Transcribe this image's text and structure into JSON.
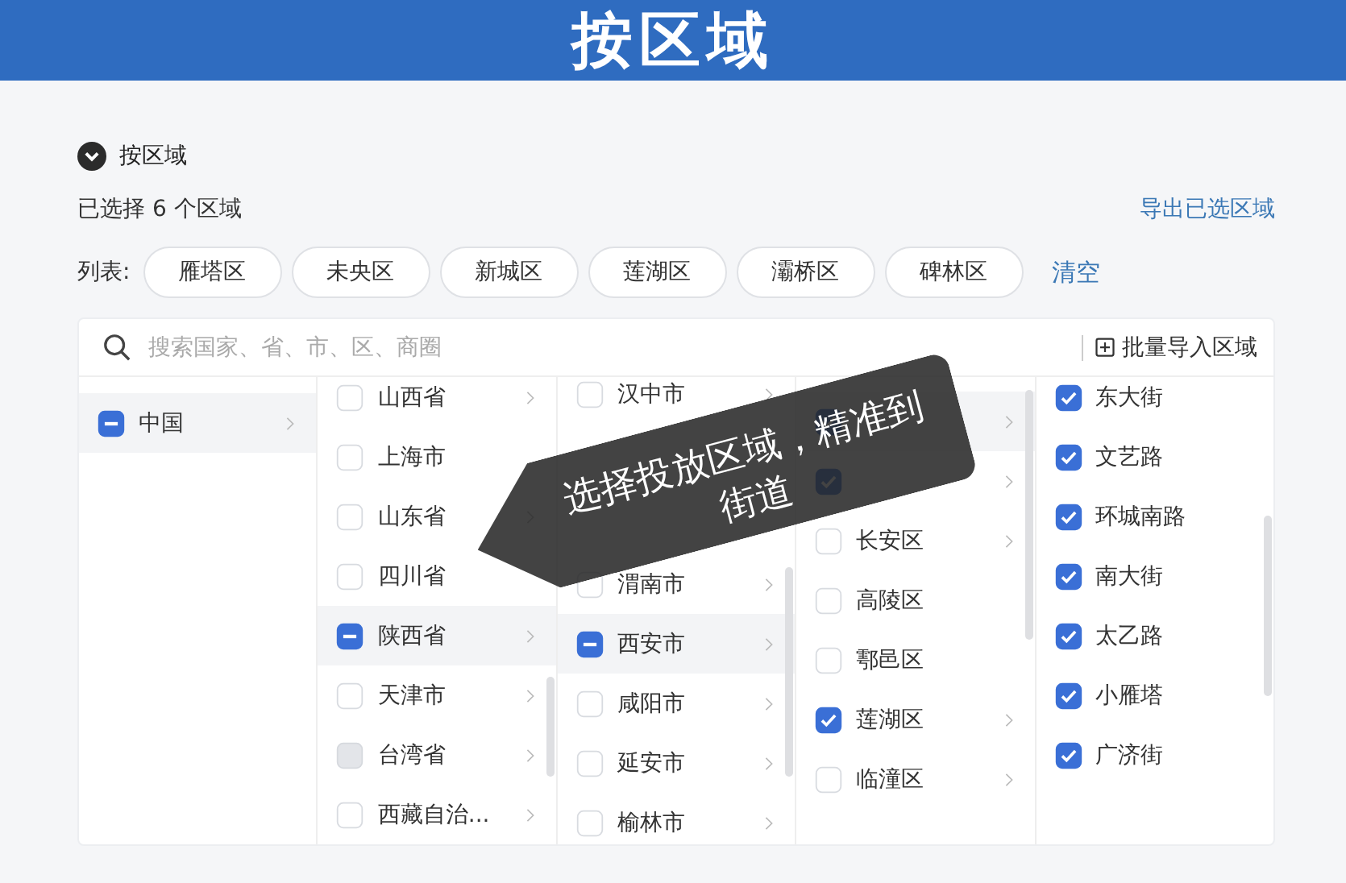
{
  "header": {
    "title": "按区域"
  },
  "section": {
    "title": "按区域",
    "expanded": true
  },
  "summary": {
    "text": "已选择 6 个区域",
    "export_link": "导出已选区域"
  },
  "chips": {
    "label": "列表:",
    "items": [
      "雁塔区",
      "未央区",
      "新城区",
      "莲湖区",
      "灞桥区",
      "碑林区"
    ],
    "clear_link": "清空"
  },
  "search": {
    "placeholder": "搜索国家、省、市、区、商圈",
    "import_button": "批量导入区域"
  },
  "columns": [
    {
      "rows": [
        {
          "kind": "option",
          "label": "中国",
          "checked": false,
          "indeterminate": true,
          "disabled": false,
          "selected": true,
          "expandable": true
        }
      ]
    },
    {
      "rows": [
        {
          "kind": "option",
          "label": "山西省",
          "checked": false,
          "indeterminate": false,
          "disabled": false,
          "selected": false,
          "expandable": true
        },
        {
          "kind": "option",
          "label": "上海市",
          "checked": false,
          "indeterminate": false,
          "disabled": false,
          "selected": false,
          "expandable": false
        },
        {
          "kind": "option",
          "label": "山东省",
          "checked": false,
          "indeterminate": false,
          "disabled": false,
          "selected": false,
          "expandable": true
        },
        {
          "kind": "option",
          "label": "四川省",
          "checked": false,
          "indeterminate": false,
          "disabled": false,
          "selected": false,
          "expandable": false
        },
        {
          "kind": "option",
          "label": "陕西省",
          "checked": false,
          "indeterminate": true,
          "disabled": false,
          "selected": true,
          "expandable": true
        },
        {
          "kind": "option",
          "label": "天津市",
          "checked": false,
          "indeterminate": false,
          "disabled": false,
          "selected": false,
          "expandable": true
        },
        {
          "kind": "option",
          "label": "台湾省",
          "checked": false,
          "indeterminate": false,
          "disabled": true,
          "selected": false,
          "expandable": true
        },
        {
          "kind": "option",
          "label": "西藏自治...",
          "checked": false,
          "indeterminate": false,
          "disabled": false,
          "selected": false,
          "expandable": true
        }
      ]
    },
    {
      "rows": [
        {
          "kind": "option",
          "label": "汉中市",
          "checked": false,
          "indeterminate": false,
          "disabled": false,
          "selected": false,
          "expandable": true
        },
        {
          "kind": "covered"
        },
        {
          "kind": "covered"
        },
        {
          "kind": "option",
          "label": "渭南市",
          "checked": false,
          "indeterminate": false,
          "disabled": false,
          "selected": false,
          "expandable": true
        },
        {
          "kind": "option",
          "label": "西安市",
          "checked": false,
          "indeterminate": true,
          "disabled": false,
          "selected": true,
          "expandable": true
        },
        {
          "kind": "option",
          "label": "咸阳市",
          "checked": false,
          "indeterminate": false,
          "disabled": false,
          "selected": false,
          "expandable": true
        },
        {
          "kind": "option",
          "label": "延安市",
          "checked": false,
          "indeterminate": false,
          "disabled": false,
          "selected": false,
          "expandable": true
        },
        {
          "kind": "option",
          "label": "榆林市",
          "checked": false,
          "indeterminate": false,
          "disabled": false,
          "selected": false,
          "expandable": true
        }
      ]
    },
    {
      "rows": [
        {
          "kind": "option",
          "checked": true,
          "indeterminate": false,
          "disabled": false,
          "selected": true,
          "expandable": true
        },
        {
          "kind": "option",
          "checked": true,
          "indeterminate": false,
          "disabled": false,
          "selected": false,
          "expandable": true
        },
        {
          "kind": "option",
          "label": "长安区",
          "checked": false,
          "indeterminate": false,
          "disabled": false,
          "selected": false,
          "expandable": true
        },
        {
          "kind": "option",
          "label": "高陵区",
          "checked": false,
          "indeterminate": false,
          "disabled": false,
          "selected": false,
          "expandable": false
        },
        {
          "kind": "option",
          "label": "鄠邑区",
          "checked": false,
          "indeterminate": false,
          "disabled": false,
          "selected": false,
          "expandable": false
        },
        {
          "kind": "option",
          "label": "莲湖区",
          "checked": true,
          "indeterminate": false,
          "disabled": false,
          "selected": false,
          "expandable": true
        },
        {
          "kind": "option",
          "label": "临潼区",
          "checked": false,
          "indeterminate": false,
          "disabled": false,
          "selected": false,
          "expandable": true
        }
      ]
    },
    {
      "rows": [
        {
          "kind": "option",
          "label": "东大街",
          "checked": true,
          "indeterminate": false,
          "disabled": false,
          "selected": false,
          "expandable": false
        },
        {
          "kind": "option",
          "label": "文艺路",
          "checked": true,
          "indeterminate": false,
          "disabled": false,
          "selected": false,
          "expandable": false
        },
        {
          "kind": "option",
          "label": "环城南路",
          "checked": true,
          "indeterminate": false,
          "disabled": false,
          "selected": false,
          "expandable": false
        },
        {
          "kind": "option",
          "label": "南大街",
          "checked": true,
          "indeterminate": false,
          "disabled": false,
          "selected": false,
          "expandable": false
        },
        {
          "kind": "option",
          "label": "太乙路",
          "checked": true,
          "indeterminate": false,
          "disabled": false,
          "selected": false,
          "expandable": false
        },
        {
          "kind": "option",
          "label": "小雁塔",
          "checked": true,
          "indeterminate": false,
          "disabled": false,
          "selected": false,
          "expandable": false
        },
        {
          "kind": "option",
          "label": "广济街",
          "checked": true,
          "indeterminate": false,
          "disabled": false,
          "selected": false,
          "expandable": false
        }
      ]
    }
  ],
  "callout": {
    "text": "选择投放区域，精准到街道"
  }
}
